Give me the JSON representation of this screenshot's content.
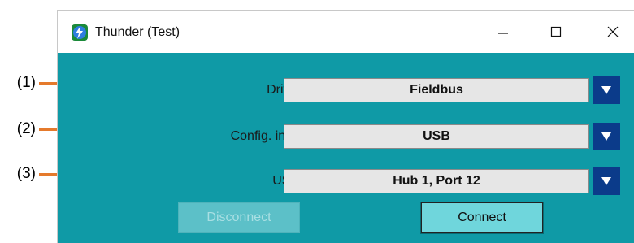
{
  "window": {
    "title": "Thunder (Test)"
  },
  "callouts": [
    "(1)",
    "(2)",
    "(3)"
  ],
  "fields": [
    {
      "label": "Drive type :",
      "value": "Fieldbus"
    },
    {
      "label": "Config. interface :",
      "value": "USB"
    },
    {
      "label": "USB port :",
      "value": "Hub 1, Port 12"
    }
  ],
  "buttons": {
    "disconnect": "Disconnect",
    "connect": "Connect"
  },
  "colors": {
    "client_bg": "#0f9aa6",
    "leader": "#e57a2c",
    "dropdown_arrow": "#0b3b8a"
  }
}
